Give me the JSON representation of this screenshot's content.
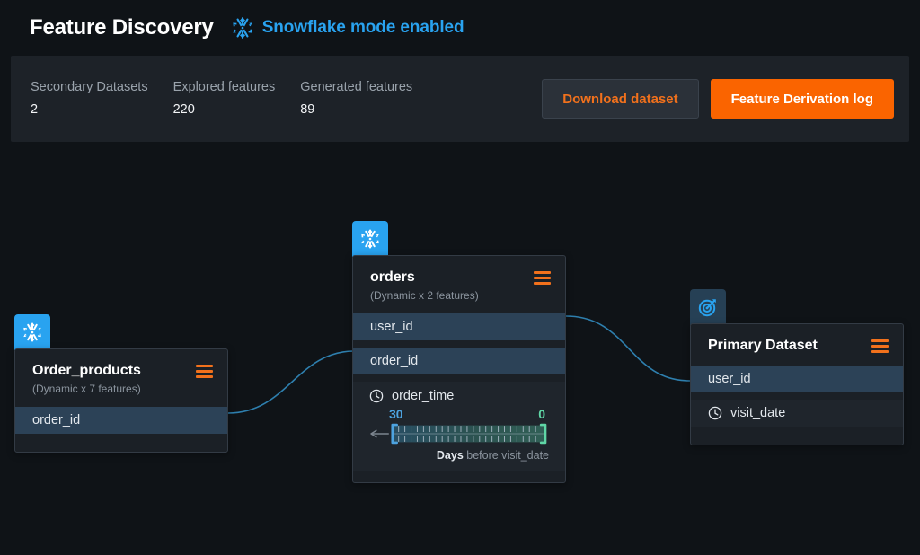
{
  "header": {
    "title": "Feature Discovery",
    "badge_icon": "snowflake-icon",
    "badge_label": "Snowflake mode enabled",
    "badge_color": "#29a3f0"
  },
  "stats": {
    "items": [
      {
        "label": "Secondary Datasets",
        "value": "2"
      },
      {
        "label": "Explored features",
        "value": "220"
      },
      {
        "label": "Generated features",
        "value": "89"
      }
    ],
    "actions": {
      "download_label": "Download dataset",
      "derivation_log_label": "Feature Derivation log",
      "secondary_color": "#f2711c",
      "primary_color": "#fa6400"
    }
  },
  "graph": {
    "nodes": [
      {
        "id": "order_products",
        "tab_icon": "snowflake-icon",
        "name": "Order_products",
        "subtitle": "(Dynamic x 7 features)",
        "menu_icon": "hamburger-icon",
        "fields": [
          {
            "name": "order_id",
            "kind": "key"
          }
        ]
      },
      {
        "id": "orders",
        "tab_icon": "snowflake-icon",
        "name": "orders",
        "subtitle": "(Dynamic x 2 features)",
        "menu_icon": "hamburger-icon",
        "fields": [
          {
            "name": "user_id",
            "kind": "key"
          },
          {
            "name": "order_id",
            "kind": "key"
          },
          {
            "name": "order_time",
            "kind": "time",
            "icon": "clock-icon"
          }
        ],
        "time_slider": {
          "start_label": "30",
          "end_label": "0",
          "unit_label": "Days",
          "caption_suffix": " before visit_date",
          "start_color": "#4da3e0",
          "end_color": "#5fd6a6",
          "tick_count": 25,
          "direction": "left"
        }
      },
      {
        "id": "primary_dataset",
        "tab_icon": "target-icon",
        "name": "Primary Dataset",
        "subtitle": "",
        "menu_icon": "hamburger-icon",
        "fields": [
          {
            "name": "user_id",
            "kind": "key"
          },
          {
            "name": "visit_date",
            "kind": "time-plain",
            "icon": "clock-icon"
          }
        ]
      }
    ],
    "edges": [
      {
        "from": "order_products.order_id",
        "to": "orders.order_id",
        "color": "#2e7fae"
      },
      {
        "from": "orders.user_id",
        "to": "primary_dataset.user_id",
        "color": "#2e7fae"
      }
    ]
  }
}
